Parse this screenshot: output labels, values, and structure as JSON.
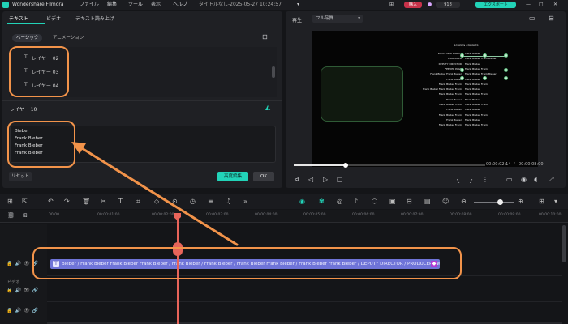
{
  "titlebar": {
    "app_name": "Wondershare Filmora",
    "menu": [
      "ファイル",
      "編集",
      "ツール",
      "表示",
      "ヘルプ"
    ],
    "doc_title": "タイトルなし-2025-05-27 10:24:57",
    "buy_label": "購入",
    "points": "918",
    "export_label": "エクスポート"
  },
  "left_panel": {
    "tabs": [
      "テキスト",
      "ビデオ",
      "テキスト読み上げ"
    ],
    "subtabs": [
      "ベーシック",
      "アニメーション"
    ],
    "layers": [
      "レイヤー 02",
      "レイヤー 03",
      "レイヤー 04"
    ],
    "layer_header": "レイヤー 10",
    "text_lines": [
      "Bieber",
      "Frank Bieber",
      "Frank Bieber",
      "Frank Bieber"
    ],
    "reset_label": "リセット",
    "advanced_label": "高度編集",
    "ok_label": "OK"
  },
  "preview": {
    "player_label": "再生",
    "quality": "フル品質",
    "current_time": "00:00:02:14",
    "total_time": "00:00:08:00",
    "progress": 0.27,
    "credits": {
      "heading": "SCREEN CREDITS",
      "left": [
        "WRITE AND DIRECT",
        "PRODUCER",
        "DEPUTY DIRECTOR",
        "FEEDER PAGE",
        "Frank Bieber Frank Bieber",
        "Frank Bieber",
        "Frank Bieber Frank",
        "Frank Bieber Frank Bieber Frank",
        "Frank Bieber Frank",
        "Frank Bieber",
        "Frank Bieber Frank",
        "Frank Bieber",
        "Frank Bieber Frank",
        "Frank Bieber",
        "Frank Bieber Frank"
      ],
      "right": [
        "Frank Bieber",
        "Frank Bieber Frank Bieber",
        "Frank Bieber",
        "Frank Bieber Frank",
        "Frank Bieber Frank Bieber",
        "Frank Bieber",
        "Frank Bieber Frank",
        "Frank Bieber",
        "Frank Bieber Frank",
        "Frank Bieber",
        "Frank Bieber Frank",
        "Frank Bieber",
        "Frank Bieber Frank",
        "Frank Bieber",
        "Frank Bieber Frank"
      ]
    }
  },
  "timeline": {
    "ticks": [
      "00:00",
      "00:00:01:00",
      "00:00:02:00",
      "00:00:03:00",
      "00:00:04:00",
      "00:00:05:00",
      "00:00:06:00",
      "00:00:07:00",
      "00:00:08:00",
      "00:00:09:00",
      "00:00:10:00"
    ],
    "track_label": "ビデオ",
    "clip_text": "Bieber / Frank Bieber Frank Bieber Frank Bieber / Frank Bieber / Frank Bieber / Frank Bieber Frank Bieber / Frank Bieber Frank Bieber / DEPUTY DIRECTOR / PRODUCER / WRITE A..."
  },
  "colors": {
    "accent": "#22d3b8",
    "clip": "#6f74d8",
    "playhead": "#e8645a",
    "annotation": "#f2934a"
  }
}
